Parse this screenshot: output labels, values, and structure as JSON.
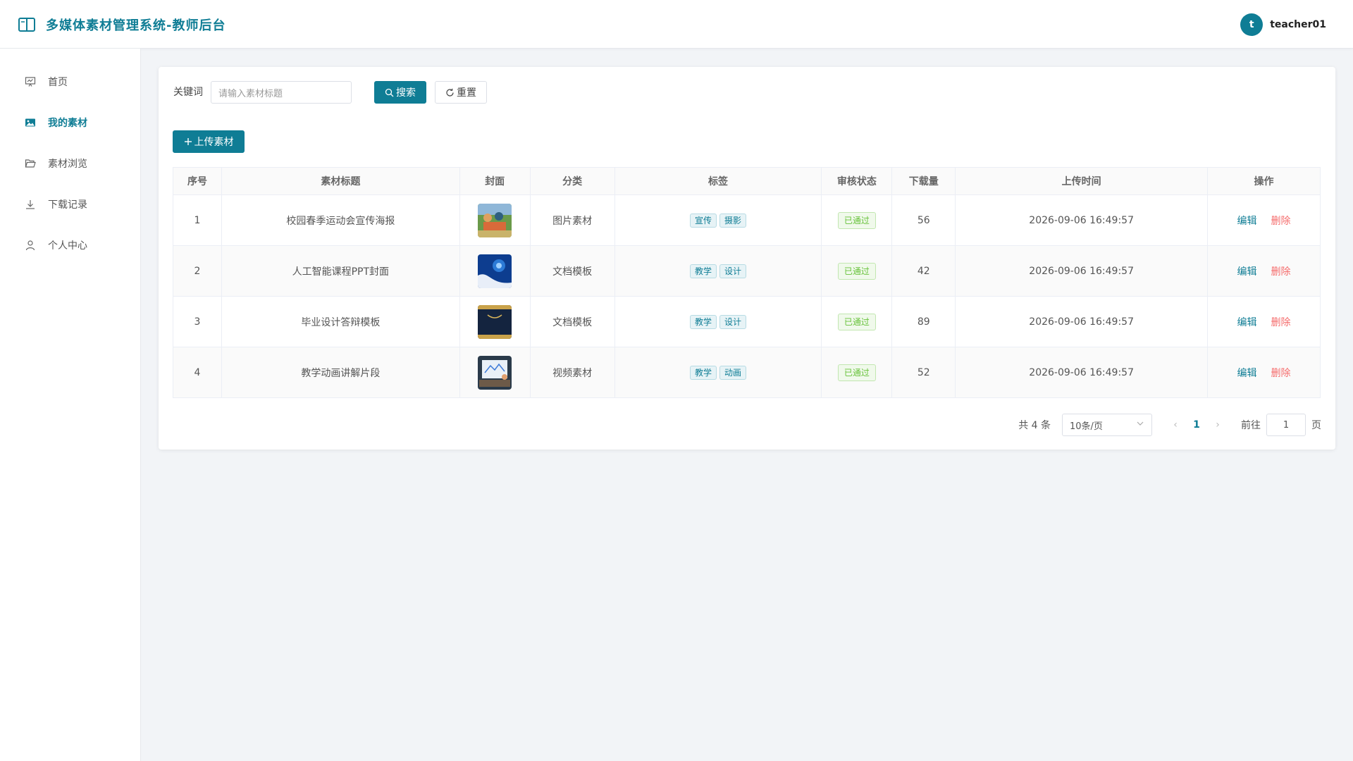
{
  "header": {
    "title": "多媒体素材管理系统-教师后台",
    "avatar_letter": "t",
    "username": "teacher01"
  },
  "sidebar": {
    "items": [
      {
        "label": "首页",
        "icon": "presentation-icon"
      },
      {
        "label": "我的素材",
        "icon": "image-icon",
        "active": true
      },
      {
        "label": "素材浏览",
        "icon": "folder-open-icon"
      },
      {
        "label": "下载记录",
        "icon": "download-icon"
      },
      {
        "label": "个人中心",
        "icon": "user-icon"
      }
    ]
  },
  "search": {
    "label": "关键词",
    "placeholder": "请输入素材标题",
    "search_btn": "搜索",
    "reset_btn": "重置"
  },
  "upload_btn": "上传素材",
  "table": {
    "headers": [
      "序号",
      "素材标题",
      "封面",
      "分类",
      "标签",
      "审核状态",
      "下载量",
      "上传时间",
      "操作"
    ],
    "rows": [
      {
        "no": "1",
        "title": "校园春季运动会宣传海报",
        "category": "图片素材",
        "tags": [
          "宣传",
          "摄影"
        ],
        "status": "已通过",
        "downloads": "56",
        "time": "2026-09-06 16:49:57"
      },
      {
        "no": "2",
        "title": "人工智能课程PPT封面",
        "category": "文档模板",
        "tags": [
          "教学",
          "设计"
        ],
        "status": "已通过",
        "downloads": "42",
        "time": "2026-09-06 16:49:57"
      },
      {
        "no": "3",
        "title": "毕业设计答辩模板",
        "category": "文档模板",
        "tags": [
          "教学",
          "设计"
        ],
        "status": "已通过",
        "downloads": "89",
        "time": "2026-09-06 16:49:57"
      },
      {
        "no": "4",
        "title": "教学动画讲解片段",
        "category": "视频素材",
        "tags": [
          "教学",
          "动画"
        ],
        "status": "已通过",
        "downloads": "52",
        "time": "2026-09-06 16:49:57"
      }
    ],
    "edit_label": "编辑",
    "delete_label": "删除"
  },
  "pagination": {
    "total": "共 4 条",
    "page_size": "10条/页",
    "current_page": "1",
    "goto_label": "前往",
    "goto_value": "1",
    "page_suffix": "页"
  },
  "colors": {
    "primary": "#0f7d95",
    "danger": "#f56c6c",
    "success": "#67c23a"
  }
}
